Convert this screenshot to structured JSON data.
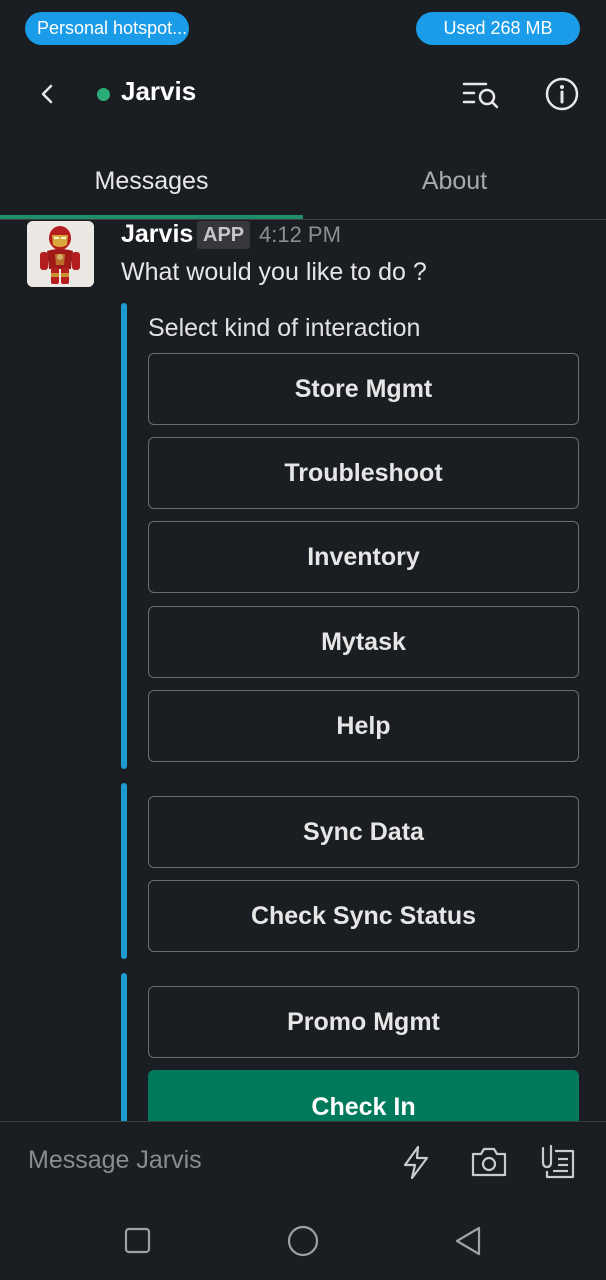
{
  "status_bar": {
    "hotspot_label": "Personal hotspot...",
    "data_used": "Used  268 MB"
  },
  "header": {
    "channel_name": "Jarvis"
  },
  "tabs": [
    {
      "label": "Messages",
      "active": true
    },
    {
      "label": "About",
      "active": false
    }
  ],
  "message": {
    "sender": "Jarvis",
    "badge": "APP",
    "time": "4:12 PM",
    "text": "What would you like to do ?",
    "block_label": "Select kind of interaction"
  },
  "buttons": {
    "group1": [
      "Store Mgmt",
      "Troubleshoot",
      "Inventory",
      "Mytask",
      "Help"
    ],
    "group2": [
      "Sync Data",
      "Check Sync Status"
    ],
    "group3": [
      "Promo Mgmt",
      "Check In"
    ]
  },
  "composer": {
    "placeholder": "Message Jarvis"
  },
  "colors": {
    "background": "#1a1d21",
    "accent_blue": "#1d9bd1",
    "primary_green": "#007a5a",
    "presence_green": "#2bac76"
  }
}
